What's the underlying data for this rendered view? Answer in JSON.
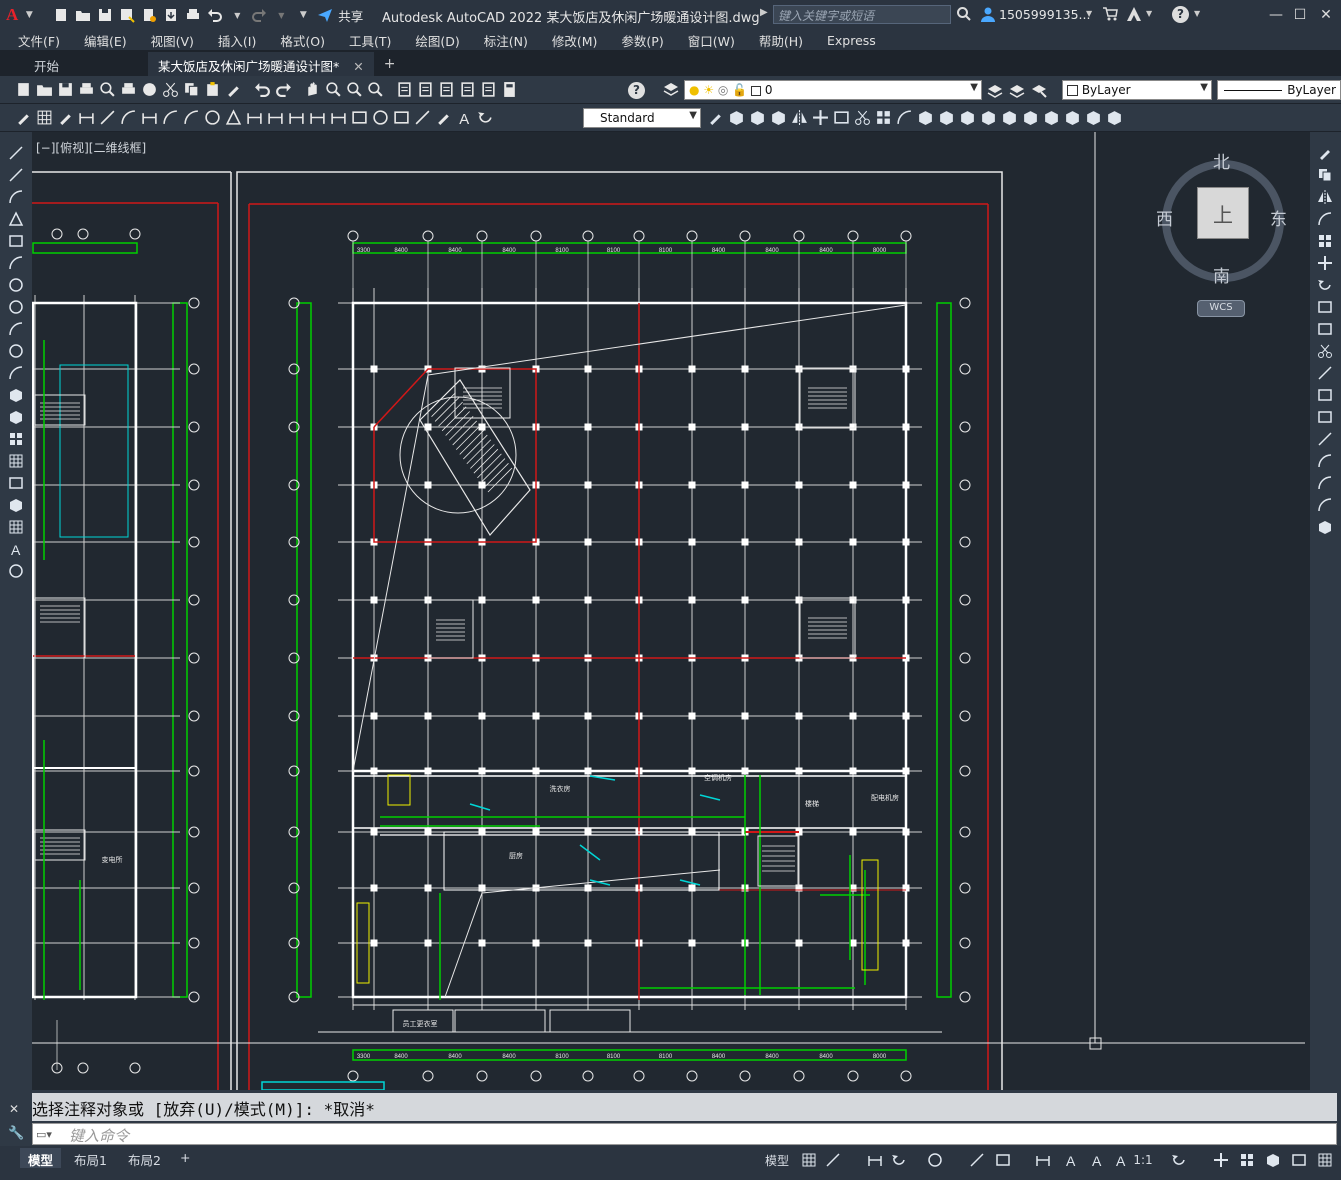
{
  "titlebar": {
    "logo": "A",
    "share_label": "共享",
    "title": "Autodesk AutoCAD 2022    某大饭店及休闲广场暖通设计图.dwg",
    "search_placeholder": "键入关键字或短语",
    "user": "1505999135...",
    "help": "?"
  },
  "menubar": {
    "items": [
      "文件(F)",
      "编辑(E)",
      "视图(V)",
      "插入(I)",
      "格式(O)",
      "工具(T)",
      "绘图(D)",
      "标注(N)",
      "修改(M)",
      "参数(P)",
      "窗口(W)",
      "帮助(H)",
      "Express"
    ]
  },
  "tabs": {
    "start": "开始",
    "active": "某大饭店及休闲广场暖通设计图*",
    "close": "✕",
    "add": "+"
  },
  "toolbar1": {
    "layer_value": "0",
    "color_value": "ByLayer",
    "linetype_value": "ByLayer"
  },
  "toolbar2": {
    "textstyle_value": "Standard"
  },
  "drawing": {
    "view_label": "[−][俯视][二维线框]",
    "viewcube": {
      "north": "北",
      "south": "南",
      "east": "东",
      "west": "西",
      "top": "上",
      "wcs": "WCS"
    },
    "room_labels": [
      "洗衣房",
      "空调机房",
      "厨房",
      "楼梯",
      "配电机房",
      "变电所",
      "员工更衣室"
    ]
  },
  "command": {
    "history": "选择注释对象或 [放弃(U)/模式(M)]: *取消*",
    "input_placeholder": "键入命令"
  },
  "statusbar": {
    "tabs": [
      "模型",
      "布局1",
      "布局2"
    ],
    "add": "+",
    "model_label": "模型",
    "scale": "1:1"
  },
  "colors": {
    "background": "#212830",
    "grid": "#e8e8e8",
    "axis_green": "#00d000",
    "red_boundary": "#d01818",
    "cyan": "#00d6d6",
    "yellow": "#f0f000"
  }
}
